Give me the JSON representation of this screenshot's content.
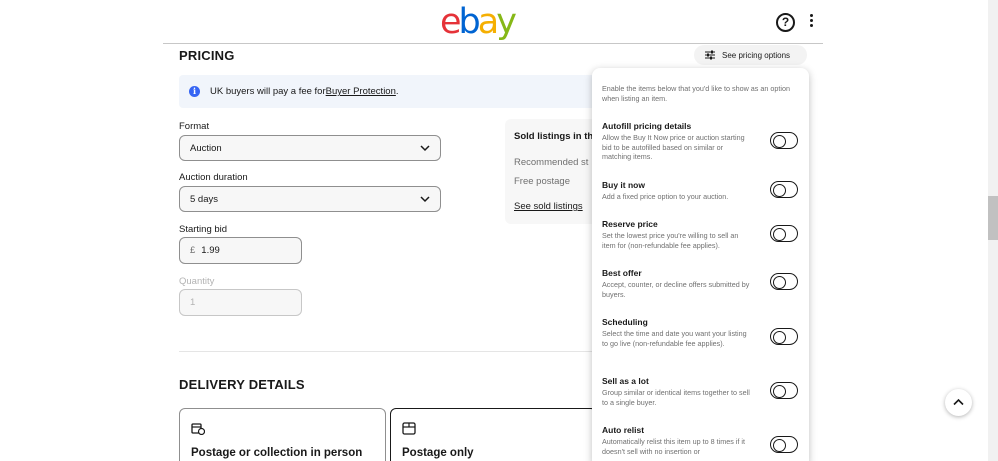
{
  "header": {
    "logo": {
      "e": "e",
      "b": "b",
      "a": "a",
      "y": "y"
    },
    "help_label": "?",
    "brand_colors": {
      "red": "#e53238",
      "blue": "#0064d2",
      "yellow": "#f5af02",
      "green": "#86b817"
    }
  },
  "pricing": {
    "title": "PRICING",
    "see_options_label": "See pricing options",
    "notice": {
      "prefix": "UK buyers will pay a fee for ",
      "link": "Buyer Protection",
      "suffix": "."
    },
    "format": {
      "label": "Format",
      "value": "Auction"
    },
    "duration": {
      "label": "Auction duration",
      "value": "5 days"
    },
    "starting_bid": {
      "label": "Starting bid",
      "currency": "£",
      "value": "1.99"
    },
    "quantity": {
      "label": "Quantity",
      "value": "1"
    },
    "sold_card": {
      "title": "Sold listings in the",
      "recommended": "Recommended st",
      "postage": "Free postage",
      "link": "See sold listings"
    }
  },
  "delivery": {
    "title": "DELIVERY DETAILS",
    "options": [
      {
        "label": "Postage or collection in person",
        "selected": false
      },
      {
        "label": "Postage only",
        "selected": true
      }
    ]
  },
  "popover": {
    "intro": "Enable the items below that you'd like to show as an option when listing an item.",
    "options": [
      {
        "title": "Autofill pricing details",
        "desc": "Allow the Buy It Now price or auction starting bid to be autofilled based on similar or matching items.",
        "enabled": false
      },
      {
        "title": "Buy it now",
        "desc": "Add a fixed price option to your auction.",
        "enabled": false
      },
      {
        "title": "Reserve price",
        "desc": "Set the lowest price you're willing to sell an item for (non-refundable fee applies).",
        "enabled": false
      },
      {
        "title": "Best offer",
        "desc": "Accept, counter, or decline offers submitted by buyers.",
        "enabled": false
      },
      {
        "title": "Scheduling",
        "desc": "Select the time and date you want your listing to go live (non-refundable fee applies).",
        "enabled": false
      },
      {
        "title": "Sell as a lot",
        "desc": "Group similar or identical items together to sell to a single buyer.",
        "enabled": false
      },
      {
        "title": "Auto relist",
        "desc": "Automatically relist this item up to 8 times if it doesn't sell with no insertion or",
        "enabled": false
      }
    ]
  },
  "colors": {
    "accent_info": "#3665f3",
    "notice_bg": "#f1f5fb",
    "text": "#191919",
    "muted": "#707070"
  }
}
